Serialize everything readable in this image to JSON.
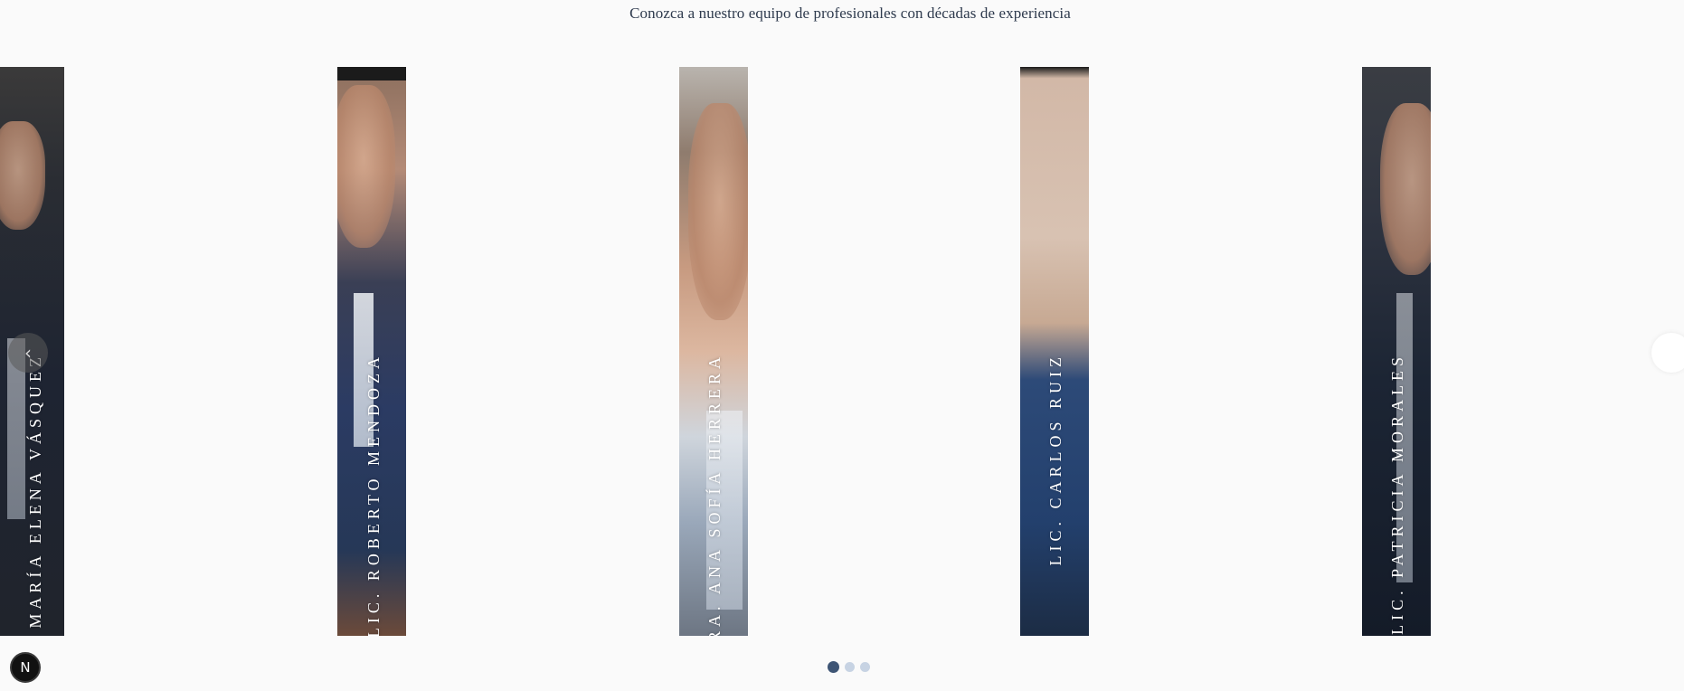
{
  "header": {
    "subtitle": "Conozca a nuestro equipo de profesionales con décadas de experiencia"
  },
  "team": [
    {
      "name": "Dra. María Elena Vásquez"
    },
    {
      "name": "Lic. Roberto Mendoza"
    },
    {
      "name": "Dra. Ana Sofía Herrera"
    },
    {
      "name": "Lic. Carlos Ruiz"
    },
    {
      "name": "Lic. Patricia Morales"
    }
  ],
  "carousel": {
    "prev_icon": "chevron-left-icon",
    "next_icon": "chevron-right-icon",
    "dots": 3,
    "active_dot": 0
  },
  "badge": {
    "label": "N"
  }
}
